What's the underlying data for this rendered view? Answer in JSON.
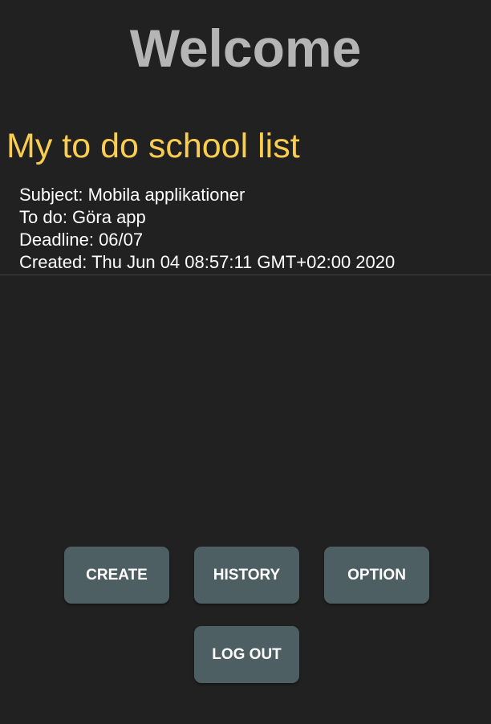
{
  "header": {
    "welcome": "Welcome"
  },
  "list": {
    "title": "My to do school list",
    "items": [
      {
        "subject": "Subject: Mobila applikationer",
        "todo": "To do: Göra app",
        "deadline": "Deadline: 06/07",
        "created": "Created: Thu Jun 04 08:57:11 GMT+02:00 2020"
      }
    ]
  },
  "buttons": {
    "create": "CREATE",
    "history": "HISTORY",
    "option": "OPTION",
    "logout": "LOG OUT"
  },
  "colors": {
    "background": "#212121",
    "welcome_text": "#b5b5b5",
    "title_accent": "#f9cd4f",
    "button_bg": "#4e5f63"
  }
}
